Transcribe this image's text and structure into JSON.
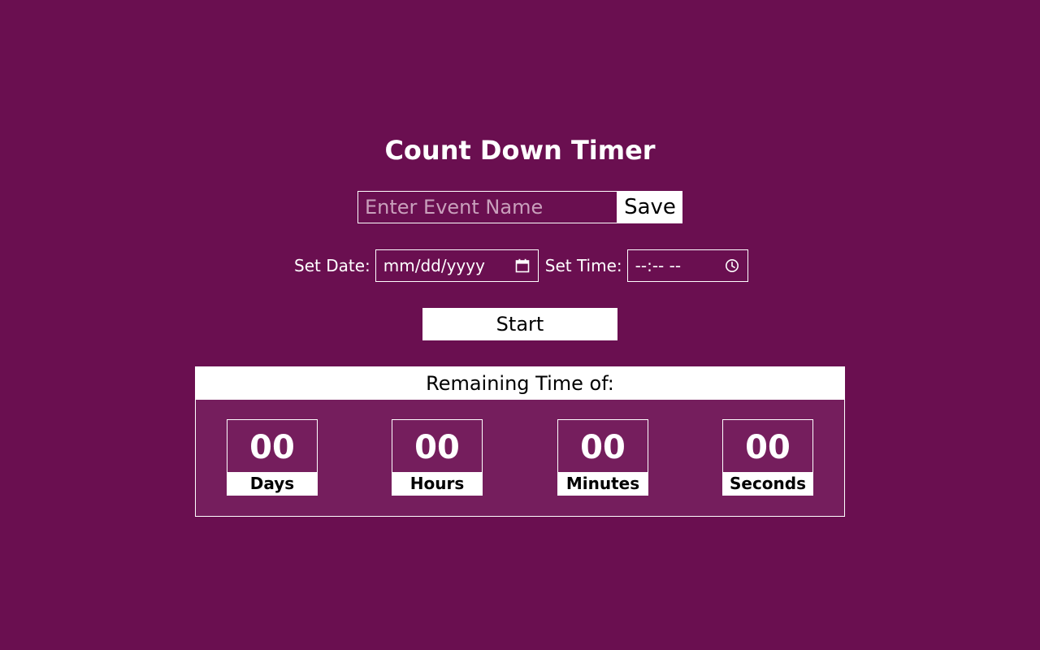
{
  "app": {
    "title": "Count Down Timer"
  },
  "event": {
    "placeholder": "Enter Event Name",
    "value": "",
    "save_label": "Save"
  },
  "date": {
    "label": "Set Date:",
    "placeholder": "mm/dd/yyyy",
    "icon": "calendar-icon"
  },
  "time": {
    "label": "Set Time:",
    "placeholder": "--:-- --",
    "icon": "clock-icon"
  },
  "start": {
    "label": "Start"
  },
  "remaining": {
    "header": "Remaining Time of:",
    "units": [
      {
        "value": "00",
        "label": "Days"
      },
      {
        "value": "00",
        "label": "Hours"
      },
      {
        "value": "00",
        "label": "Minutes"
      },
      {
        "value": "00",
        "label": "Seconds"
      }
    ]
  },
  "colors": {
    "background": "#6a0f50",
    "panel": "#751e5d",
    "foreground": "#ffffff",
    "button_text": "#000000"
  }
}
